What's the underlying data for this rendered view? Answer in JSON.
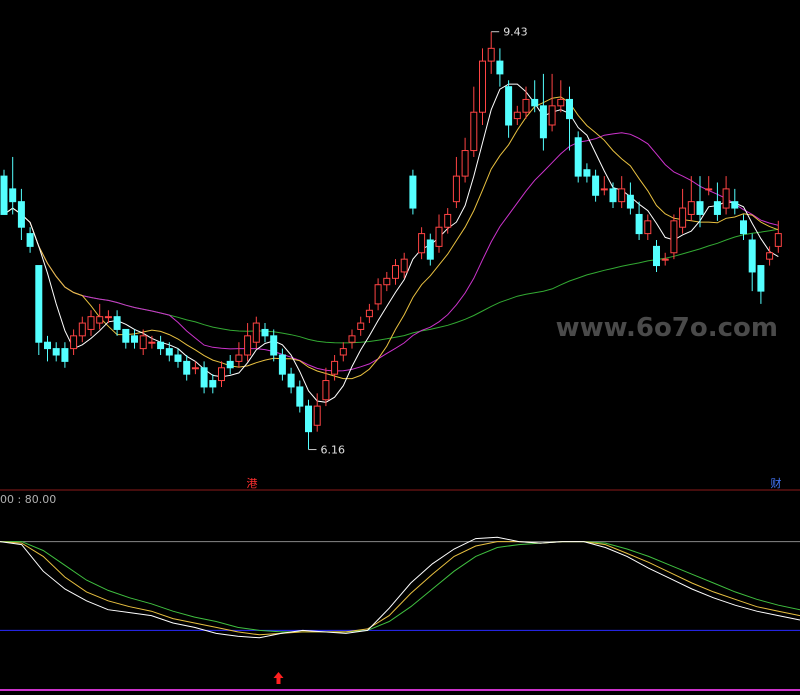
{
  "chart_data": [
    {
      "type": "candlestick",
      "panel": "price",
      "annotations": {
        "high_label": "9.43",
        "low_label": "6.16",
        "event_1": "港",
        "event_2": "财"
      },
      "watermark": "www.6o7o.com",
      "ylim": [
        6.0,
        9.6
      ],
      "candles": [
        [
          8.3,
          8.0,
          8.35,
          8.0
        ],
        [
          8.2,
          8.1,
          8.45,
          8.0
        ],
        [
          8.1,
          7.9,
          8.2,
          7.8
        ],
        [
          7.85,
          7.75,
          7.9,
          7.7
        ],
        [
          7.6,
          7.0,
          7.6,
          6.9
        ],
        [
          7.0,
          6.95,
          7.05,
          6.85
        ],
        [
          6.95,
          6.9,
          7.0,
          6.85
        ],
        [
          6.95,
          6.85,
          7.0,
          6.8
        ],
        [
          6.95,
          7.05,
          7.1,
          6.9
        ],
        [
          7.05,
          7.15,
          7.2,
          7.0
        ],
        [
          7.1,
          7.2,
          7.25,
          7.05
        ],
        [
          7.15,
          7.2,
          7.3,
          7.1
        ],
        [
          7.2,
          7.2,
          7.25,
          7.15
        ],
        [
          7.2,
          7.1,
          7.25,
          7.05
        ],
        [
          7.1,
          7.0,
          7.1,
          6.95
        ],
        [
          7.05,
          7.0,
          7.1,
          6.95
        ],
        [
          6.95,
          7.05,
          7.1,
          6.9
        ],
        [
          7.0,
          7.0,
          7.05,
          6.95
        ],
        [
          7.0,
          6.95,
          7.05,
          6.9
        ],
        [
          6.95,
          6.9,
          7.0,
          6.85
        ],
        [
          6.9,
          6.85,
          6.95,
          6.8
        ],
        [
          6.85,
          6.75,
          6.9,
          6.7
        ],
        [
          6.8,
          6.8,
          6.85,
          6.75
        ],
        [
          6.8,
          6.65,
          6.85,
          6.6
        ],
        [
          6.7,
          6.65,
          6.75,
          6.6
        ],
        [
          6.7,
          6.8,
          6.85,
          6.65
        ],
        [
          6.85,
          6.8,
          6.9,
          6.75
        ],
        [
          6.85,
          6.9,
          7.0,
          6.8
        ],
        [
          6.9,
          7.05,
          7.15,
          6.85
        ],
        [
          7.0,
          7.15,
          7.2,
          6.95
        ],
        [
          7.1,
          7.05,
          7.15,
          7.0
        ],
        [
          7.05,
          6.9,
          7.1,
          6.85
        ],
        [
          6.9,
          6.75,
          6.95,
          6.7
        ],
        [
          6.75,
          6.65,
          6.8,
          6.6
        ],
        [
          6.65,
          6.5,
          6.7,
          6.45
        ],
        [
          6.5,
          6.3,
          6.55,
          6.16
        ],
        [
          6.35,
          6.5,
          6.6,
          6.3
        ],
        [
          6.55,
          6.7,
          6.8,
          6.5
        ],
        [
          6.75,
          6.85,
          6.9,
          6.7
        ],
        [
          6.9,
          6.95,
          7.0,
          6.85
        ],
        [
          7.0,
          7.05,
          7.1,
          6.95
        ],
        [
          7.1,
          7.15,
          7.2,
          7.05
        ],
        [
          7.2,
          7.25,
          7.3,
          7.15
        ],
        [
          7.3,
          7.45,
          7.5,
          7.25
        ],
        [
          7.45,
          7.5,
          7.55,
          7.4
        ],
        [
          7.5,
          7.6,
          7.65,
          7.45
        ],
        [
          7.55,
          7.65,
          7.7,
          7.5
        ],
        [
          8.3,
          8.05,
          8.35,
          8.0
        ],
        [
          7.7,
          7.85,
          7.9,
          7.65
        ],
        [
          7.8,
          7.65,
          7.85,
          7.6
        ],
        [
          7.75,
          7.9,
          8.0,
          7.7
        ],
        [
          7.9,
          8.0,
          8.05,
          7.85
        ],
        [
          8.1,
          8.3,
          8.45,
          8.05
        ],
        [
          8.3,
          8.5,
          8.6,
          8.25
        ],
        [
          8.5,
          8.8,
          9.0,
          8.45
        ],
        [
          8.8,
          9.2,
          9.3,
          8.7
        ],
        [
          9.2,
          9.3,
          9.43,
          9.1
        ],
        [
          9.2,
          9.1,
          9.3,
          9.0
        ],
        [
          9.0,
          8.7,
          9.05,
          8.6
        ],
        [
          8.75,
          8.8,
          8.85,
          8.7
        ],
        [
          8.8,
          8.9,
          9.0,
          8.75
        ],
        [
          8.9,
          8.85,
          9.05,
          8.8
        ],
        [
          8.85,
          8.6,
          9.1,
          8.5
        ],
        [
          8.7,
          8.85,
          9.1,
          8.65
        ],
        [
          8.85,
          8.9,
          9.05,
          8.8
        ],
        [
          8.9,
          8.75,
          9.0,
          8.5
        ],
        [
          8.6,
          8.3,
          8.65,
          8.25
        ],
        [
          8.35,
          8.3,
          8.4,
          8.25
        ],
        [
          8.3,
          8.15,
          8.35,
          8.1
        ],
        [
          8.2,
          8.2,
          8.3,
          8.15
        ],
        [
          8.2,
          8.1,
          8.25,
          8.05
        ],
        [
          8.1,
          8.2,
          8.3,
          8.05
        ],
        [
          8.15,
          8.05,
          8.25,
          8.0
        ],
        [
          8.0,
          7.85,
          8.1,
          7.8
        ],
        [
          7.85,
          7.95,
          8.0,
          7.8
        ],
        [
          7.75,
          7.6,
          7.8,
          7.55
        ],
        [
          7.65,
          7.65,
          7.7,
          7.6
        ],
        [
          7.7,
          7.95,
          8.0,
          7.65
        ],
        [
          7.9,
          8.05,
          8.2,
          7.85
        ],
        [
          8.0,
          8.1,
          8.3,
          7.95
        ],
        [
          8.1,
          8.0,
          8.3,
          7.9
        ],
        [
          8.2,
          8.2,
          8.3,
          8.15
        ],
        [
          8.1,
          8.0,
          8.25,
          7.95
        ],
        [
          8.05,
          8.2,
          8.3,
          8.0
        ],
        [
          8.1,
          8.05,
          8.2,
          8.0
        ],
        [
          7.95,
          7.85,
          8.0,
          7.8
        ],
        [
          7.8,
          7.55,
          7.85,
          7.4
        ],
        [
          7.6,
          7.4,
          7.6,
          7.3
        ],
        [
          7.65,
          7.7,
          7.75,
          7.6
        ],
        [
          7.75,
          7.85,
          7.95,
          7.7
        ]
      ]
    },
    {
      "type": "line",
      "panel": "indicator",
      "header": "00 : 80.00",
      "ylim": [
        0,
        100
      ],
      "reference_lines": {
        "upper": 80,
        "lower": 20
      },
      "signal_marker": "buy",
      "series": [
        {
          "color": "#ffffff",
          "values": [
            80,
            78,
            60,
            48,
            40,
            34,
            32,
            30,
            25,
            22,
            18,
            16,
            15,
            18,
            20,
            19,
            18,
            20,
            35,
            52,
            65,
            75,
            82,
            83,
            80,
            79,
            80,
            80,
            76,
            70,
            62,
            55,
            48,
            42,
            37,
            33,
            30,
            27
          ]
        },
        {
          "color": "#e8c040",
          "values": [
            80,
            79,
            70,
            56,
            46,
            40,
            36,
            33,
            28,
            25,
            22,
            19,
            17,
            18,
            19,
            19,
            19,
            21,
            30,
            45,
            58,
            70,
            77,
            80,
            80,
            79,
            80,
            80,
            78,
            72,
            66,
            59,
            52,
            46,
            41,
            36,
            33,
            30
          ]
        },
        {
          "color": "#40c040",
          "values": [
            80,
            80,
            74,
            64,
            54,
            47,
            42,
            38,
            33,
            29,
            26,
            22,
            20,
            19,
            19,
            19,
            19,
            20,
            26,
            36,
            48,
            60,
            70,
            76,
            78,
            79,
            80,
            80,
            79,
            75,
            70,
            64,
            58,
            52,
            46,
            41,
            37,
            34
          ]
        }
      ]
    }
  ],
  "colors": {
    "background": "#000000",
    "up_candle": "#ff4444",
    "down_candle": "#54ffff",
    "ma5": "#ffffff",
    "ma10": "#e8c040",
    "ma20": "#cc33cc",
    "ma60": "#33aa33",
    "separator": "#8b1a1a",
    "upper_ref": "#888888",
    "lower_ref": "#2a2aff",
    "bottom_line": "#cc33cc",
    "event_1_color": "#ff3030",
    "event_2_color": "#4477ff",
    "signal_color": "#ff2020"
  }
}
